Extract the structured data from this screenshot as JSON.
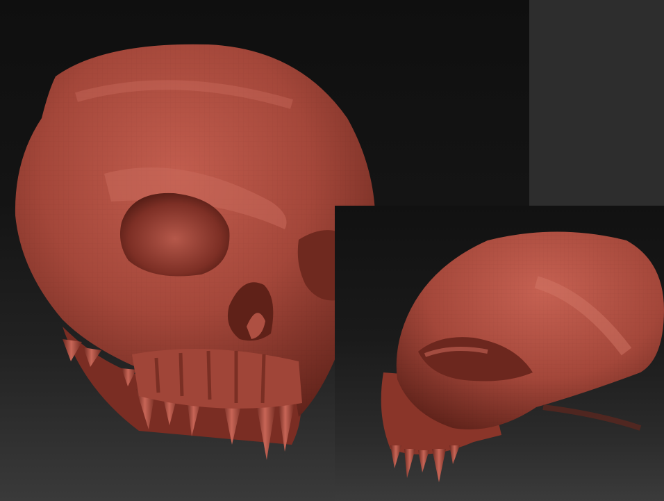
{
  "viewport": {
    "background": "#2b2b2b",
    "panel_shade": "#111111"
  },
  "skull_front": {
    "subject": "demon-skull-sculpt",
    "view": "three-quarter-front",
    "material_color": "#a4473a"
  },
  "skull_side": {
    "subject": "demon-skull-sculpt",
    "view": "side-profile",
    "material_color": "#a4473a"
  }
}
